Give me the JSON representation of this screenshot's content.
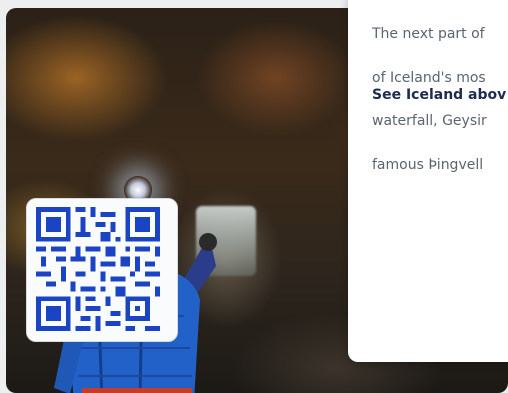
{
  "card": {
    "description_lines": [
      "The next part of",
      "of Iceland's mos",
      "waterfall, Geysir",
      "famous Þingvell"
    ],
    "link_label": "See Iceland abov"
  },
  "colors": {
    "qr": "#1a44c4",
    "link": "#1d2c4e",
    "body_text": "#5a6470",
    "jacket": "#2262c8"
  }
}
